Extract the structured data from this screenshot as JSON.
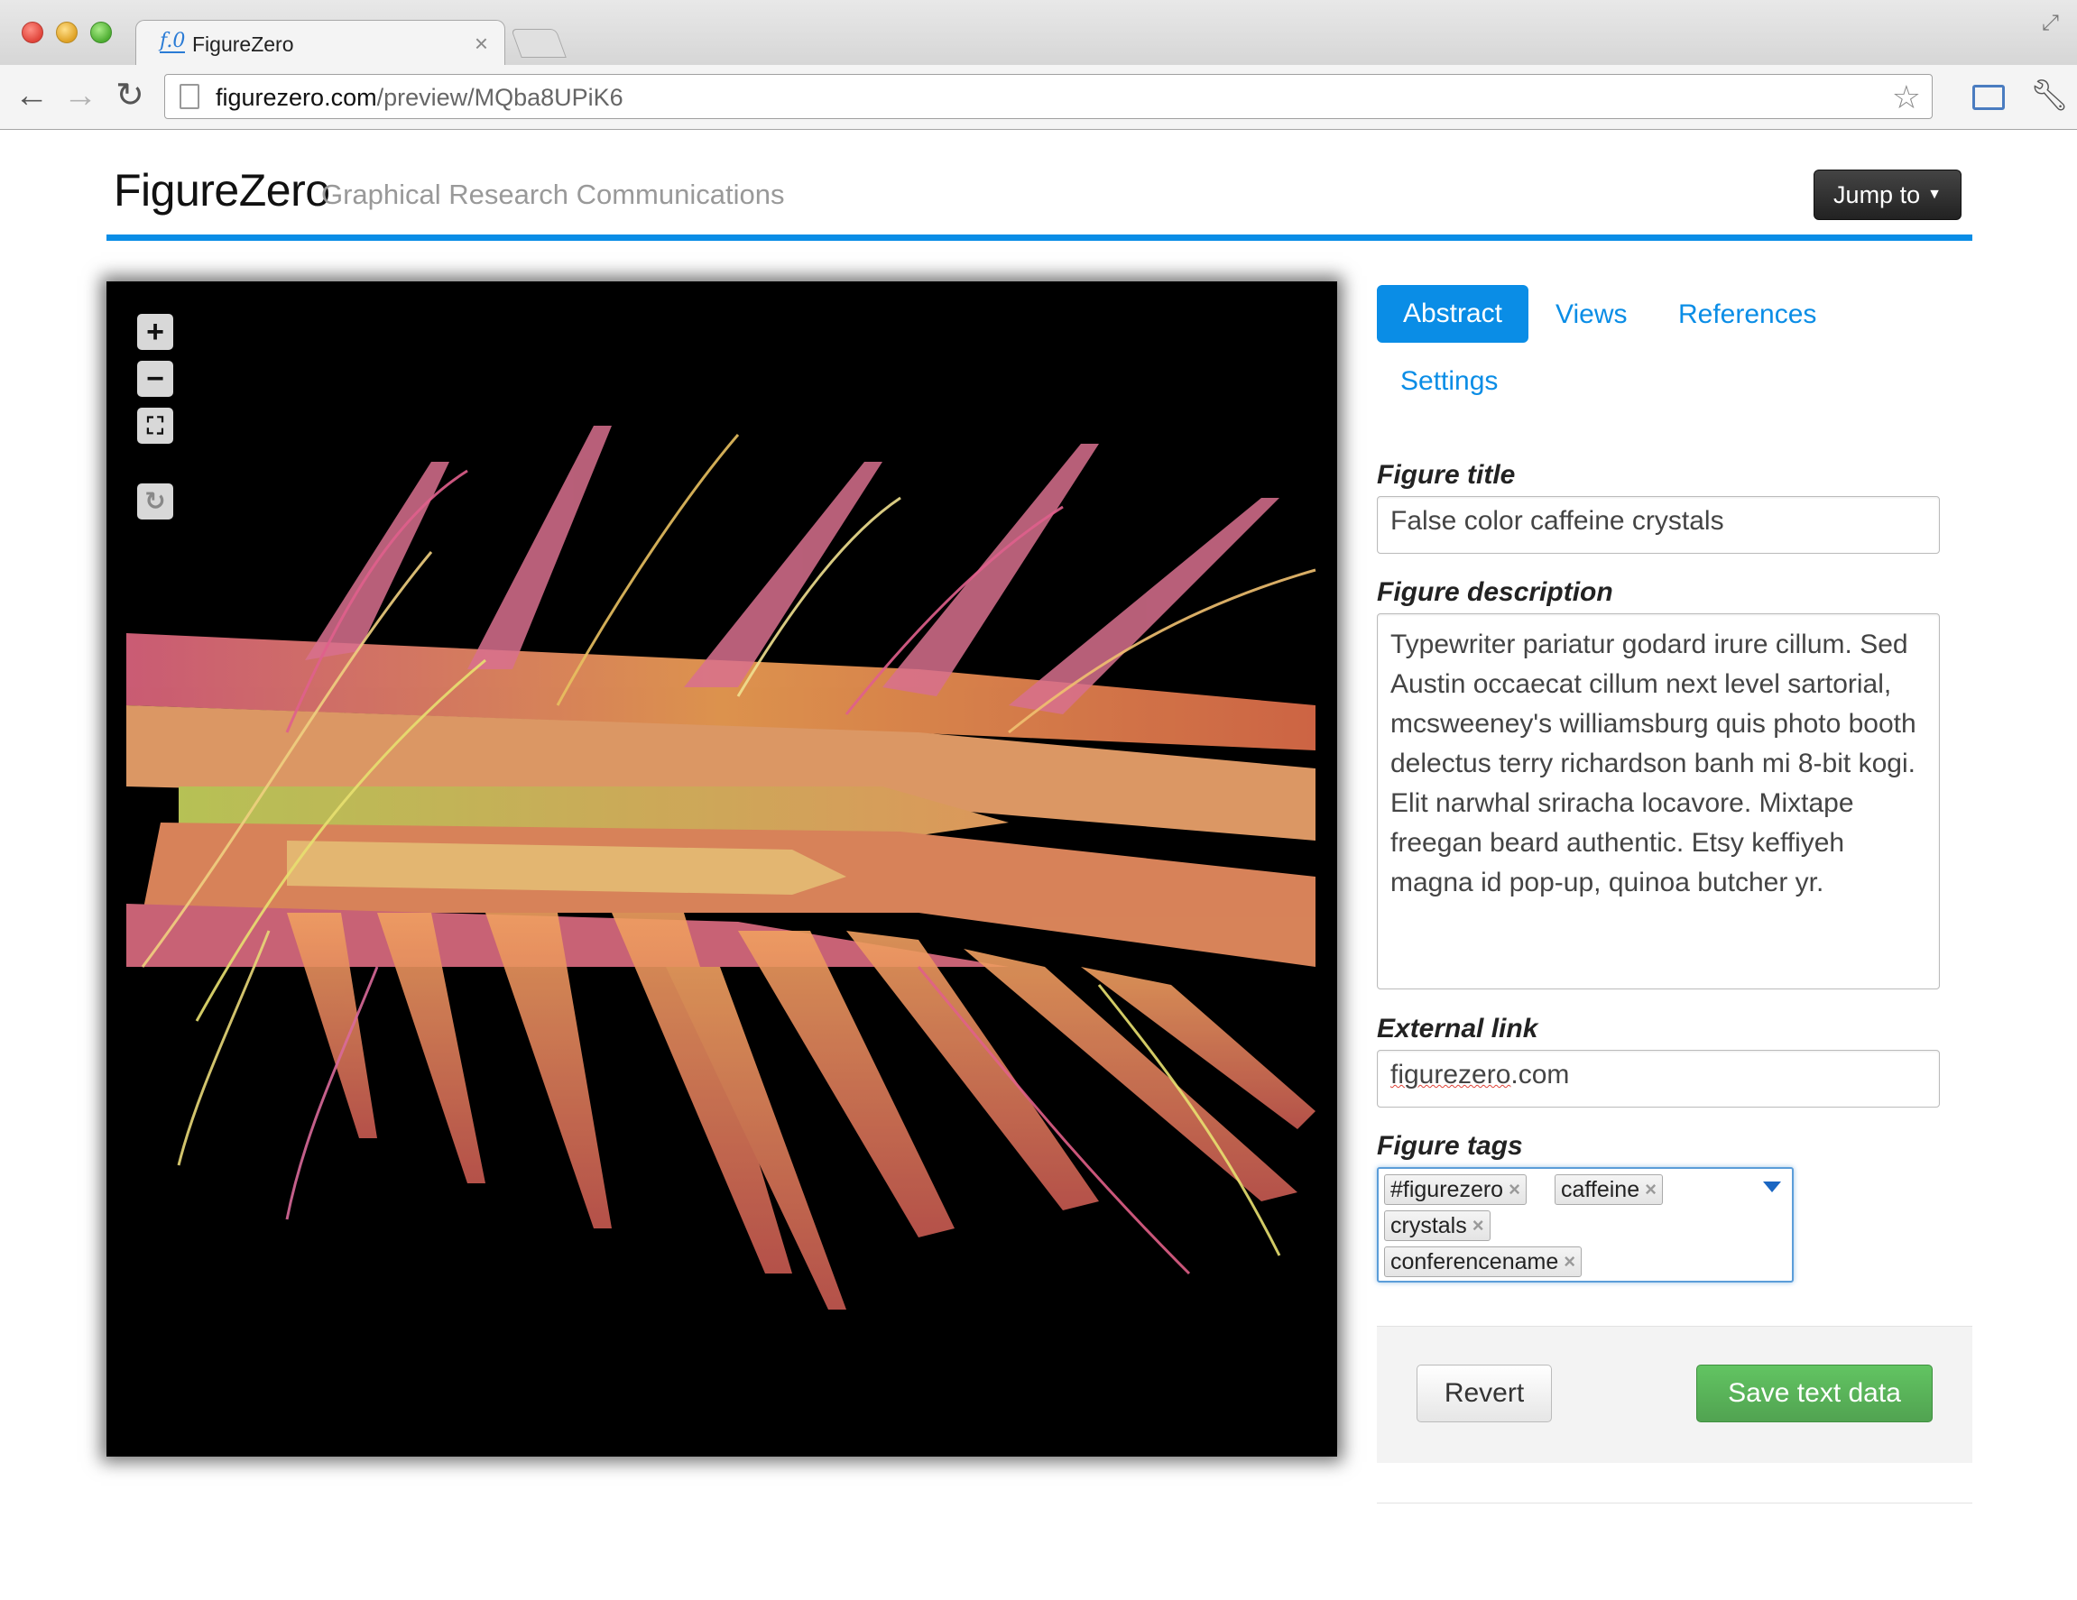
{
  "browser": {
    "tab_title": "FigureZero",
    "tab_favicon": "f.0",
    "url_host": "figurezero.com",
    "url_path": "/preview/MQba8UPiK6",
    "icons": [
      "back-icon",
      "forward-icon",
      "reload-icon",
      "page-icon",
      "star-icon",
      "cast-icon",
      "wrench-icon",
      "close-icon",
      "fullscreen-icon"
    ]
  },
  "header": {
    "brand": "FigureZero",
    "tagline": "Graphical Research Communications",
    "jump_label": "Jump to",
    "accent_color": "#0a8de6"
  },
  "viewer": {
    "controls": [
      "zoom-in-icon",
      "zoom-out-icon",
      "fit-screen-icon",
      "rotate-icon"
    ],
    "background": "#000000"
  },
  "tabs": [
    {
      "label": "Abstract",
      "active": true
    },
    {
      "label": "Views",
      "active": false
    },
    {
      "label": "References",
      "active": false
    },
    {
      "label": "Settings",
      "active": false
    }
  ],
  "form": {
    "title_label": "Figure title",
    "title_value": "False color caffeine crystals",
    "description_label": "Figure description",
    "description_value": "Typewriter pariatur godard irure cillum. Sed Austin occaecat cillum next level sartorial, mcsweeney's williamsburg quis photo booth delectus terry richardson banh mi 8-bit kogi. Elit narwhal sriracha locavore. Mixtape freegan beard authentic. Etsy keffiyeh magna id pop-up, quinoa butcher yr.",
    "link_label": "External link",
    "link_value_main": "figurezero",
    "link_value_suffix": ".com",
    "tags_label": "Figure tags",
    "tags": [
      "#figurezero",
      "caffeine",
      "crystals",
      "conferencename"
    ],
    "tag_remove_glyph": "×",
    "revert_label": "Revert",
    "save_label": "Save text data",
    "save_color": "#5bb75b"
  }
}
